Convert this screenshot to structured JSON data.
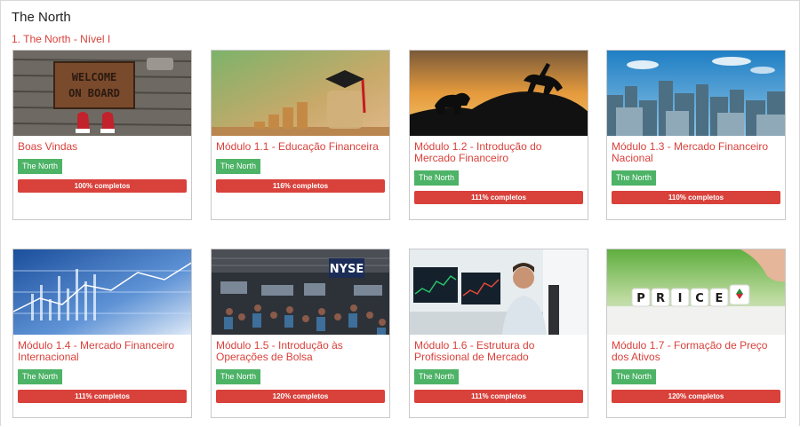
{
  "page": {
    "title": "The North",
    "level_title": "1. The North - Nível I"
  },
  "colors": {
    "accent": "#d9413b",
    "tag": "#4db367",
    "progress": "#d9413b"
  },
  "cards": [
    {
      "title": "Boas Vindas",
      "tag": "The North",
      "progress": "100% completos",
      "image": "welcome-on-board-doormat"
    },
    {
      "title": "Módulo 1.1 - Educação Financeira",
      "tag": "The North",
      "progress": "116% completos",
      "image": "coins-graduation-cap"
    },
    {
      "title": "Módulo 1.2 - Introdução do Mercado Financeiro",
      "tag": "The North",
      "progress": "111% completos",
      "image": "bull-and-bear-silhouette"
    },
    {
      "title": "Módulo 1.3 - Mercado Financeiro Nacional",
      "tag": "The North",
      "progress": "110% completos",
      "image": "city-skyline"
    },
    {
      "title": "Módulo 1.4 - Mercado Financeiro Internacional",
      "tag": "The North",
      "progress": "111% completos",
      "image": "blue-financial-chart"
    },
    {
      "title": "Módulo 1.5 - Introdução às Operações de Bolsa",
      "tag": "The North",
      "progress": "120% completos",
      "image": "stock-exchange-floor"
    },
    {
      "title": "Módulo 1.6 - Estrutura do Profissional de Mercado",
      "tag": "The North",
      "progress": "111% completos",
      "image": "trader-at-monitors"
    },
    {
      "title": "Módulo 1.7 - Formação de Preço dos Ativos",
      "tag": "The North",
      "progress": "120% completos",
      "image": "price-dice"
    }
  ],
  "image_texts": {
    "doormat": "WELCOME ON BOARD",
    "exchange": "NYSE",
    "dice": [
      "P",
      "R",
      "I",
      "C",
      "E"
    ]
  }
}
